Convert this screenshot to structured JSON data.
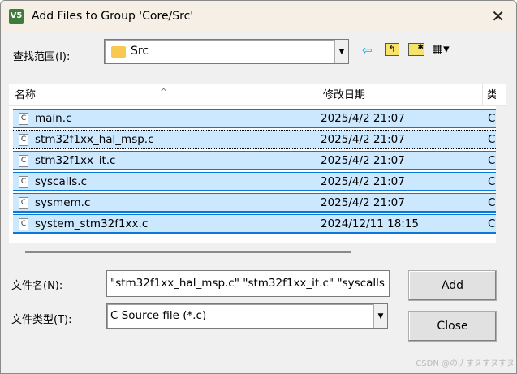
{
  "window": {
    "title": "Add Files to Group 'Core/Src'",
    "app_icon": "keil-uvision-icon",
    "close_glyph": "✕"
  },
  "lookin": {
    "label": "查找范围(I):",
    "value": "Src"
  },
  "toolbar": {
    "back": "⇦",
    "up": "↰",
    "new_folder": "✱",
    "view": "▦▾"
  },
  "columns": [
    "名称",
    "修改日期",
    "类型"
  ],
  "files": [
    {
      "name": "main.c",
      "date": "2025/4/2 21:07",
      "type": "C 源文件"
    },
    {
      "name": "stm32f1xx_hal_msp.c",
      "date": "2025/4/2 21:07",
      "type": "C 源文件"
    },
    {
      "name": "stm32f1xx_it.c",
      "date": "2025/4/2 21:07",
      "type": "C 源文件"
    },
    {
      "name": "syscalls.c",
      "date": "2025/4/2 21:07",
      "type": "C 源文件"
    },
    {
      "name": "sysmem.c",
      "date": "2025/4/2 21:07",
      "type": "C 源文件"
    },
    {
      "name": "system_stm32f1xx.c",
      "date": "2024/12/11 18:15",
      "type": "C 源文件"
    }
  ],
  "filename": {
    "label": "文件名(N):",
    "value": "\"stm32f1xx_hal_msp.c\" \"stm32f1xx_it.c\" \"syscalls"
  },
  "filetype": {
    "label": "文件类型(T):",
    "value": "C Source file (*.c)"
  },
  "buttons": {
    "add": "Add",
    "close": "Close"
  },
  "watermark": "CSDN @の丿すヌすヌすヌ"
}
